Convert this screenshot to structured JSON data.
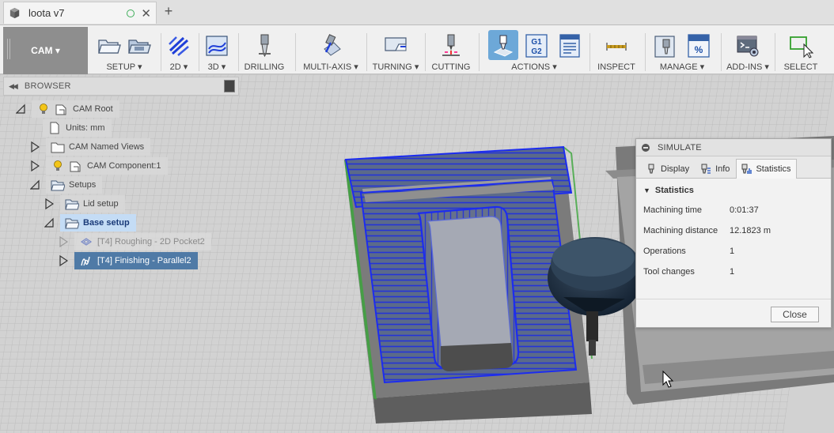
{
  "window": {
    "tab_title": "loota v7",
    "new_tab_symbol": "+",
    "close_symbol": "✕"
  },
  "toolbar": {
    "workspace_label": "CAM ▾",
    "groups": {
      "setup": "SETUP ▾",
      "two_d": "2D ▾",
      "three_d": "3D ▾",
      "drilling": "DRILLING",
      "multi_axis": "MULTI-AXIS ▾",
      "turning": "TURNING ▾",
      "cutting": "CUTTING",
      "actions": "ACTIONS ▾",
      "inspect": "INSPECT",
      "manage": "MANAGE ▾",
      "add_ins": "ADD-INS ▾",
      "select": "SELECT"
    },
    "actions_icon_text": {
      "g1": "G1",
      "g2": "G2"
    },
    "manage_icon_text": "%"
  },
  "browser": {
    "title": "BROWSER",
    "collapse_symbol": "◀◀",
    "nodes": {
      "root": "CAM Root",
      "units": "Units: mm",
      "named_views": "CAM Named Views",
      "component": "CAM Component:1",
      "setups": "Setups",
      "lid_setup": "Lid setup",
      "base_setup": "Base setup",
      "op_roughing": "[T4] Roughing - 2D Pocket2",
      "op_finishing": "[T4] Finishing - Parallel2"
    }
  },
  "simulate": {
    "title": "SIMULATE",
    "tabs": {
      "display": "Display",
      "info": "Info",
      "statistics": "Statistics"
    },
    "section": "Statistics",
    "section_caret": "▼",
    "stats": {
      "machining_time_label": "Machining time",
      "machining_time_value": "0:01:37",
      "machining_distance_label": "Machining distance",
      "machining_distance_value": "12.1823 m",
      "operations_label": "Operations",
      "operations_value": "1",
      "tool_changes_label": "Tool changes",
      "tool_changes_value": "1"
    },
    "close_label": "Close"
  },
  "colors": {
    "toolpath_blue": "#1c2cf0",
    "stock_gray": "#6b6b6b",
    "active_node": "#4f7aa6",
    "selected_node": "#c4dcf5"
  }
}
